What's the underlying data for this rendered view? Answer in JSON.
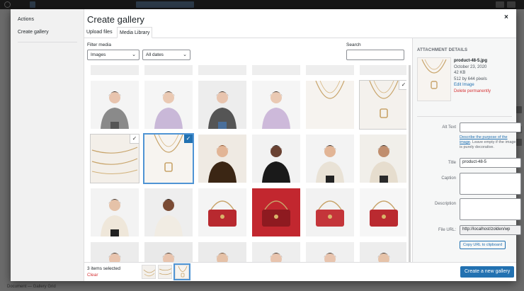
{
  "background": {
    "footer_text": "Document  —  Gallery Grid"
  },
  "menu": {
    "heading": "Actions",
    "items": [
      {
        "label": "Create gallery"
      }
    ]
  },
  "modal": {
    "title": "Create gallery",
    "close_icon": "×",
    "tabs": [
      {
        "label": "Upload files"
      },
      {
        "label": "Media Library"
      }
    ]
  },
  "filters": {
    "label": "Filter media",
    "type_value": "Images",
    "date_value": "All dates",
    "search_label": "Search",
    "search_value": ""
  },
  "grid": {
    "tiles": [
      {
        "kind": "person-grey-coat"
      },
      {
        "kind": "person-lilac-sweater"
      },
      {
        "kind": "person-denim"
      },
      {
        "kind": "person-lilac-sweater-arms"
      },
      {
        "kind": "necklace-gold-long"
      },
      {
        "kind": "necklace-gold-lock",
        "state": "selected"
      },
      {
        "kind": "necklace-chains",
        "state": "selected"
      },
      {
        "kind": "necklace-lock",
        "state": "details"
      },
      {
        "kind": "person-leopard"
      },
      {
        "kind": "person-black-top"
      },
      {
        "kind": "person-cream-knit"
      },
      {
        "kind": "person-cream-cardigan"
      },
      {
        "kind": "person-cream-boots"
      },
      {
        "kind": "person-laughing"
      },
      {
        "kind": "bag-red-chain"
      },
      {
        "kind": "bag-red-open"
      },
      {
        "kind": "bag-red-small"
      },
      {
        "kind": "bag-red-logo"
      },
      {
        "kind": "person-white-shirt"
      },
      {
        "kind": "person-white-blouse"
      },
      {
        "kind": "person-white-portrait"
      },
      {
        "kind": "person-white-crop"
      },
      {
        "kind": "person-white-collar"
      },
      {
        "kind": "person-white-back"
      }
    ]
  },
  "details": {
    "heading": "ATTACHMENT DETAILS",
    "filename": "product-48-5.jpg",
    "date": "October 23, 2020",
    "size": "42 KB",
    "dimensions": "512 by 644 pixels",
    "edit_link": "Edit Image",
    "delete_link": "Delete permanently",
    "alt_label": "Alt Text",
    "alt_value": "",
    "alt_help_link": "Describe the purpose of the image",
    "alt_help_rest": ". Leave empty if the image is purely decorative.",
    "title_label": "Title",
    "title_value": "product-48-5",
    "caption_label": "Caption",
    "caption_value": "",
    "description_label": "Description",
    "description_value": "",
    "url_label": "File URL:",
    "url_value": "http://localhost/zolden/wp",
    "copy_label": "Copy URL to clipboard"
  },
  "toolbar": {
    "selected_text": "3 items selected",
    "clear_label": "Clear",
    "create_label": "Create a new gallery"
  },
  "colors": {
    "accent": "#2271b1",
    "danger": "#d63638",
    "selection_outline": "#4f94d4"
  }
}
